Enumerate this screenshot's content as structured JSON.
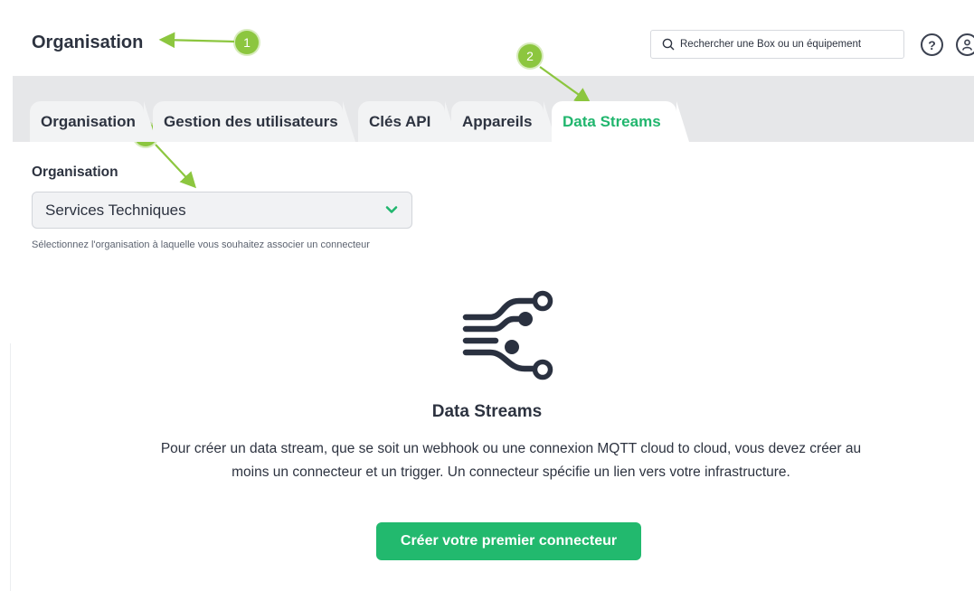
{
  "header": {
    "title": "Organisation",
    "search_placeholder": "Rechercher une Box ou un équipement",
    "help_icon": "question-icon",
    "user_icon": "user-icon"
  },
  "tabs": [
    {
      "label": "Organisation",
      "active": false
    },
    {
      "label": "Gestion des utilisateurs",
      "active": false
    },
    {
      "label": "Clés API",
      "active": false
    },
    {
      "label": "Appareils",
      "active": false
    },
    {
      "label": "Data Streams",
      "active": true
    }
  ],
  "form": {
    "label": "Organisation",
    "selected": "Services Techniques",
    "helper": "Sélectionnez l'organisation à laquelle vous souhaitez associer un connecteur"
  },
  "empty_state": {
    "icon": "data-streams-icon",
    "title": "Data Streams",
    "description": "Pour créer un data stream, que se soit un webhook ou une connexion MQTT cloud to cloud, vous devez créer au moins un connecteur et un trigger. Un connecteur spécifie un lien vers votre infrastructure.",
    "button": "Créer votre premier connecteur"
  },
  "annotations": [
    "1",
    "2",
    "3"
  ],
  "colors": {
    "accent": "#21b66e",
    "annotation": "#8cc63f",
    "text": "#2d3340",
    "tabbar": "#e6e7e9"
  }
}
